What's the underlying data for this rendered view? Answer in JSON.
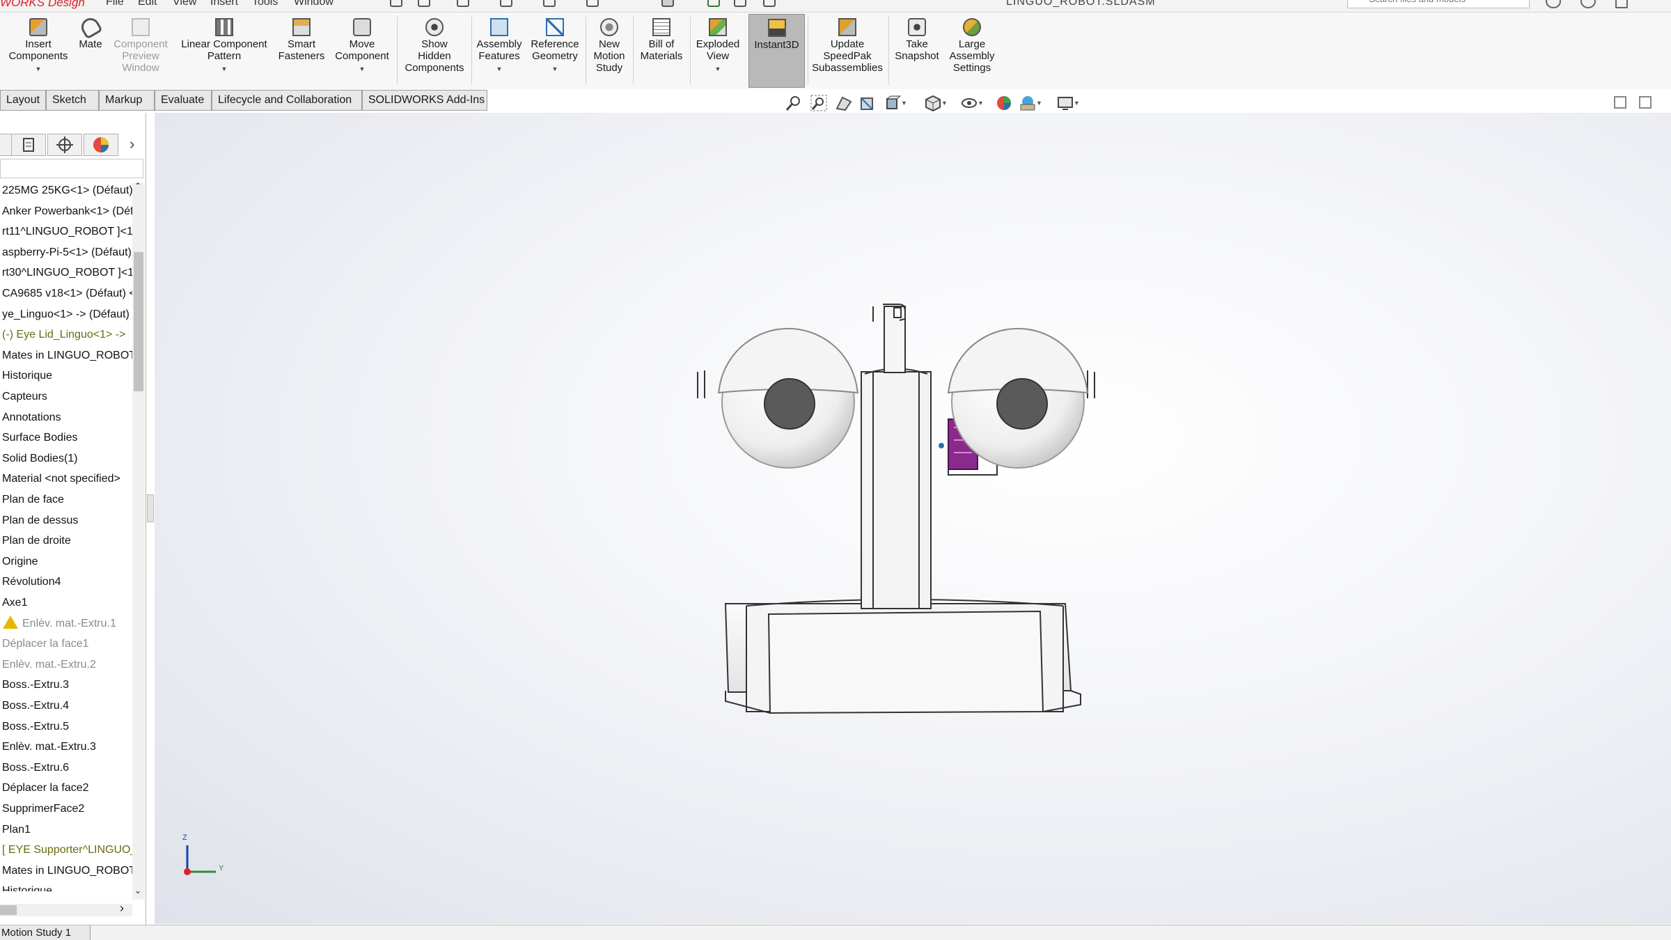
{
  "app": {
    "name": "WORKS Design",
    "document_title": "LINGUO_ROBOT.SLDASM"
  },
  "menu": [
    "File",
    "Edit",
    "View",
    "Insert",
    "Tools",
    "Window"
  ],
  "search": {
    "placeholder": "Search files and models"
  },
  "ribbon": {
    "insert_components": "Insert\nComponents",
    "mate": "Mate",
    "component_preview": "Component\nPreview\nWindow",
    "linear_pattern": "Linear Component\nPattern",
    "smart_fasteners": "Smart\nFasteners",
    "move_component": "Move\nComponent",
    "show_hidden": "Show\nHidden\nComponents",
    "assembly_features": "Assembly\nFeatures",
    "reference_geometry": "Reference\nGeometry",
    "new_motion_study": "New\nMotion\nStudy",
    "bill_of_materials": "Bill of\nMaterials",
    "exploded_view": "Exploded\nView",
    "instant3d": "Instant3D",
    "update_speedpak": "Update\nSpeedPak\nSubassemblies",
    "take_snapshot": "Take\nSnapshot",
    "large_assembly": "Large\nAssembly\nSettings"
  },
  "tabs": [
    "Layout",
    "Sketch",
    "Markup",
    "Evaluate",
    "Lifecycle and Collaboration",
    "SOLIDWORKS Add-Ins"
  ],
  "tree": [
    {
      "label": "225MG 25KG<1> (Défaut) ·",
      "style": "normal"
    },
    {
      "label": "Anker Powerbank<1> (Défa",
      "style": "normal"
    },
    {
      "label": "rt11^LINGUO_ROBOT ]<1>",
      "style": "normal"
    },
    {
      "label": "aspberry-Pi-5<1> (Défaut)",
      "style": "normal"
    },
    {
      "label": "rt30^LINGUO_ROBOT ]<1>",
      "style": "normal"
    },
    {
      "label": "CA9685 v18<1> (Défaut) <",
      "style": "normal"
    },
    {
      "label": "ye_Linguo<1> -> (Défaut)",
      "style": "normal"
    },
    {
      "label": "(-) Eye Lid_Linguo<1> ->",
      "style": "olive"
    },
    {
      "label": "Mates in LINGUO_ROBOT",
      "style": "normal"
    },
    {
      "label": "Historique",
      "style": "normal"
    },
    {
      "label": "Capteurs",
      "style": "normal"
    },
    {
      "label": "Annotations",
      "style": "normal"
    },
    {
      "label": "Surface Bodies",
      "style": "normal"
    },
    {
      "label": "Solid Bodies(1)",
      "style": "normal"
    },
    {
      "label": "Material <not specified>",
      "style": "normal"
    },
    {
      "label": "Plan de face",
      "style": "normal"
    },
    {
      "label": "Plan de dessus",
      "style": "normal"
    },
    {
      "label": "Plan de droite",
      "style": "normal"
    },
    {
      "label": "Origine",
      "style": "normal"
    },
    {
      "label": "Révolution4",
      "style": "normal"
    },
    {
      "label": "Axe1",
      "style": "normal"
    },
    {
      "label": "Enlèv. mat.-Extru.1",
      "style": "warn"
    },
    {
      "label": "Déplacer la face1",
      "style": "muted"
    },
    {
      "label": "Enlèv. mat.-Extru.2",
      "style": "muted"
    },
    {
      "label": "Boss.-Extru.3",
      "style": "normal"
    },
    {
      "label": "Boss.-Extru.4",
      "style": "normal"
    },
    {
      "label": "Boss.-Extru.5",
      "style": "normal"
    },
    {
      "label": "Enlèv. mat.-Extru.3",
      "style": "normal"
    },
    {
      "label": "Boss.-Extru.6",
      "style": "normal"
    },
    {
      "label": "Déplacer la face2",
      "style": "normal"
    },
    {
      "label": "SupprimerFace2",
      "style": "normal"
    },
    {
      "label": "Plan1",
      "style": "normal"
    },
    {
      "label": "[ EYE Supporter^LINGUO_",
      "style": "olive"
    },
    {
      "label": "Mates in LINGUO_ROBOT",
      "style": "normal"
    },
    {
      "label": "Historique",
      "style": "normal"
    }
  ],
  "triad": {
    "z": "Z",
    "y": "Y"
  },
  "bottom": {
    "motion_tab": "Motion Study 1"
  },
  "colors": {
    "accent_red": "#d8232a",
    "active_button": "#b9b9b9",
    "pcb_purple": "#8a2a8c"
  }
}
